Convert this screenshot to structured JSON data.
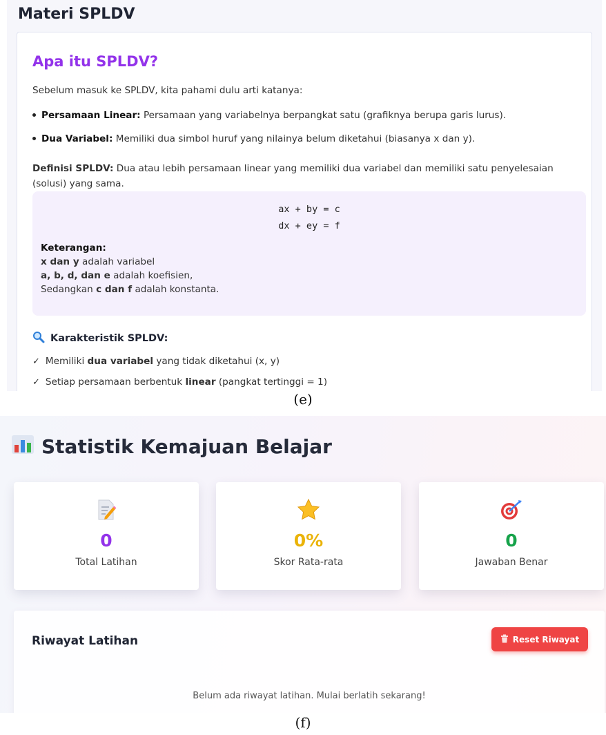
{
  "panel_e": {
    "page_title": "Materi SPLDV",
    "heading": "Apa itu SPLDV?",
    "intro": "Sebelum masuk ke SPLDV, kita pahami dulu arti katanya:",
    "bullets": [
      {
        "term": "Persamaan Linear:",
        "desc": "Persamaan yang variabelnya berpangkat satu (grafiknya berupa garis lurus)."
      },
      {
        "term": "Dua Variabel:",
        "desc": "Memiliki dua simbol huruf yang nilainya belum diketahui (biasanya x dan y)."
      }
    ],
    "definition": {
      "term": "Definisi SPLDV:",
      "desc": "Dua atau lebih persamaan linear yang memiliki dua variabel dan memiliki satu penyelesaian (solusi) yang sama."
    },
    "formula": {
      "line1": "ax + by = c",
      "line2": "dx + ey = f"
    },
    "keterangan": {
      "title": "Keterangan:",
      "line1_bold": "x dan y",
      "line1_rest": " adalah variabel",
      "line2_bold": "a, b, d, dan e",
      "line2_rest": " adalah koefisien,",
      "line3_pre": "Sedangkan ",
      "line3_bold": "c dan f",
      "line3_rest": " adalah konstanta."
    },
    "karakteristik_title": "Karakteristik SPLDV:",
    "checks": [
      {
        "pre": "Memiliki ",
        "bold": "dua variabel",
        "post": " yang tidak diketahui (x, y)"
      },
      {
        "pre": "Setiap persamaan berbentuk ",
        "bold": "linear",
        "post": " (pangkat tertinggi = 1)"
      }
    ],
    "check_symbol": "✓",
    "icon": "magnifier-icon",
    "label": "(e)"
  },
  "panel_f": {
    "title": "Statistik Kemajuan Belajar",
    "title_icon": "bar-chart-icon",
    "stats": [
      {
        "icon": "memo-icon",
        "value": "0",
        "label": "Total Latihan",
        "color": "#9333ea"
      },
      {
        "icon": "star-icon",
        "value": "0%",
        "label": "Skor Rata-rata",
        "color": "#eab308"
      },
      {
        "icon": "target-icon",
        "value": "0",
        "label": "Jawaban Benar",
        "color": "#16a34a"
      }
    ],
    "history": {
      "title": "Riwayat Latihan",
      "reset_label": "Reset Riwayat",
      "reset_icon": "trash-icon",
      "reset_color": "#ef4444",
      "empty_text": "Belum ada riwayat latihan. Mulai berlatih sekarang!"
    },
    "label": "(f)"
  }
}
